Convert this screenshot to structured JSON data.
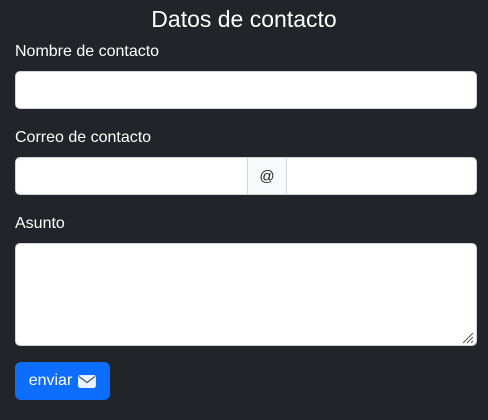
{
  "form": {
    "title": "Datos de contacto",
    "name_label": "Nombre de contacto",
    "name_value": "",
    "email_label": "Correo de contacto",
    "email_user_value": "",
    "email_addon": "@",
    "email_domain_value": "",
    "subject_label": "Asunto",
    "subject_value": "",
    "submit_label": "enviar",
    "submit_icon": "envelope-icon"
  },
  "colors": {
    "background": "#212529",
    "primary": "#0d6efd",
    "input_border": "#ced4da",
    "addon_bg": "#f8f9fa"
  }
}
